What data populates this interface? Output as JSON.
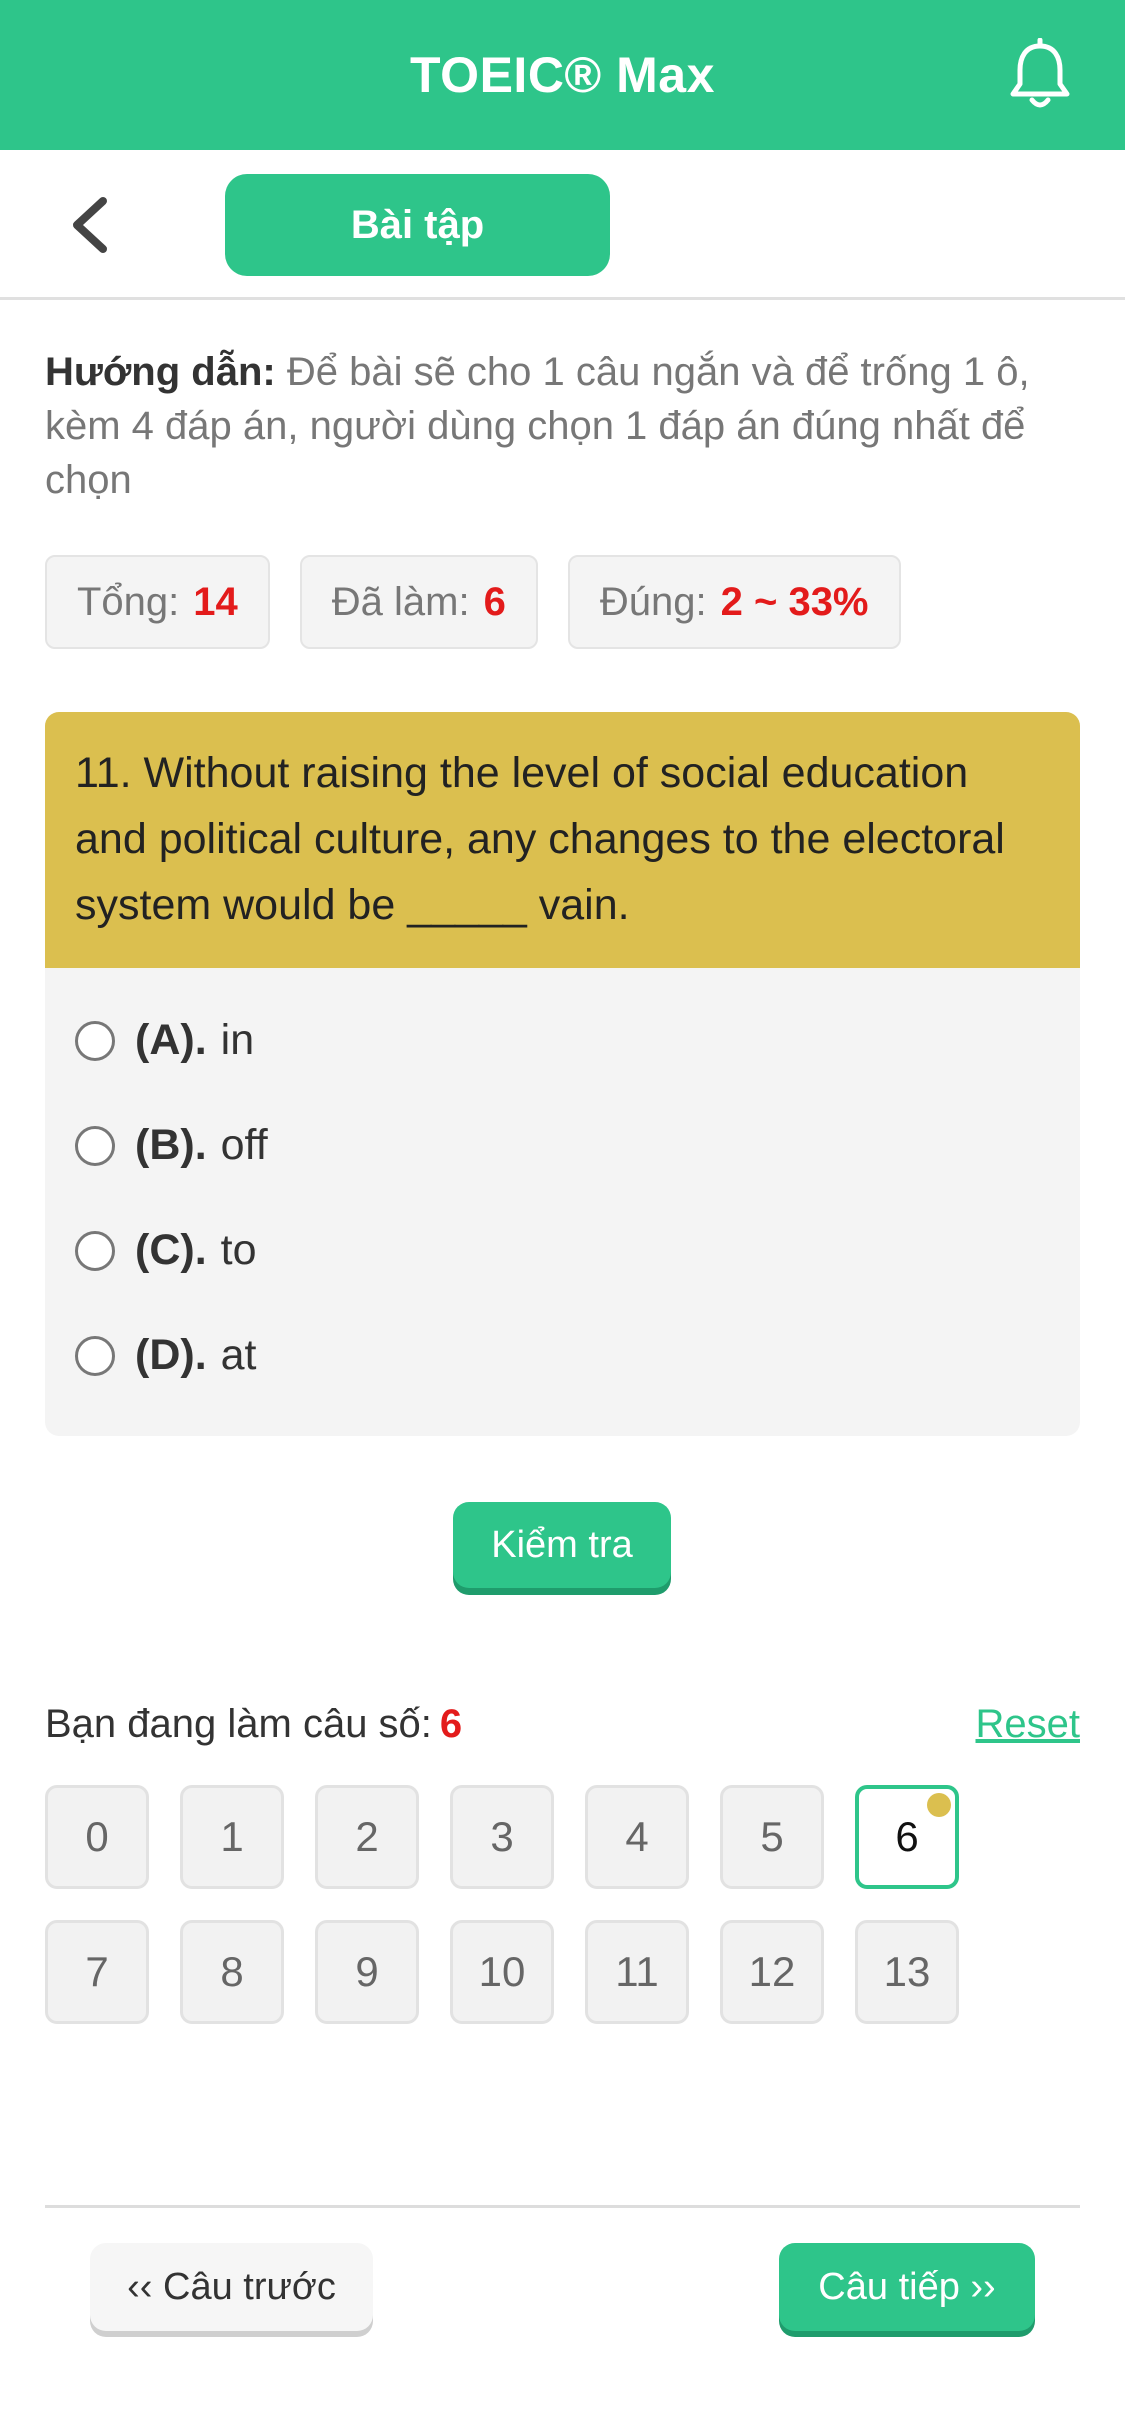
{
  "header": {
    "title": "TOEIC® Max",
    "bell_icon": "bell-icon"
  },
  "subheader": {
    "back_icon": "chevron-left-icon",
    "tab_label": "Bài tập"
  },
  "guide": {
    "label": "Hướng dẫn:",
    "text": "Để bài sẽ cho 1 câu ngắn và để trống 1 ô, kèm 4 đáp án, người dùng chọn 1 đáp án đúng nhất để chọn"
  },
  "stats": {
    "total_label": "Tổng:",
    "total_value": "14",
    "done_label": "Đã làm:",
    "done_value": "6",
    "correct_label": "Đúng:",
    "correct_value": "2 ~ 33%"
  },
  "question": {
    "text": "11. Without raising the level of social education and political culture, any changes to the electoral system would be _____ vain.",
    "options": [
      {
        "letter": "(A).",
        "text": "in"
      },
      {
        "letter": "(B).",
        "text": "off"
      },
      {
        "letter": "(C).",
        "text": "to"
      },
      {
        "letter": "(D).",
        "text": "at"
      }
    ]
  },
  "check_button": "Kiểm tra",
  "progress": {
    "label": "Bạn đang làm câu số:",
    "current": "6",
    "reset_label": "Reset"
  },
  "question_numbers": [
    "0",
    "1",
    "2",
    "3",
    "4",
    "5",
    "6",
    "7",
    "8",
    "9",
    "10",
    "11",
    "12",
    "13"
  ],
  "nav": {
    "prev_label": "‹‹ Câu trước",
    "next_label": "Câu tiếp ››"
  },
  "colors": {
    "brand": "#2ec58a",
    "question_bg": "#dbbf4f",
    "highlight": "#e31b1b"
  }
}
